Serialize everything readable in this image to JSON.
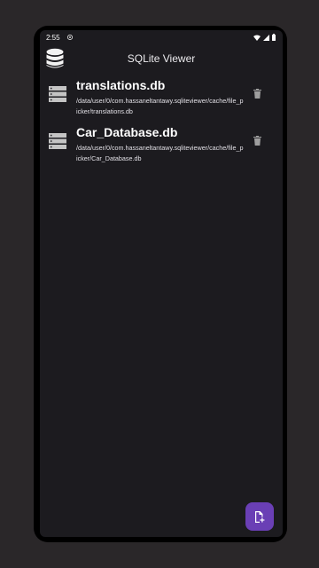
{
  "status_bar": {
    "time": "2:55",
    "icons": [
      "notification-icon",
      "wifi-icon",
      "signal-icon",
      "battery-icon"
    ]
  },
  "app_bar": {
    "title": "SQLite Viewer",
    "logo_icon": "database-icon"
  },
  "databases": [
    {
      "name": "translations.db",
      "path": "/data/user/0/com.hassaneltantawy.sqliteviewer/cache/file_picker/translations.db",
      "icon": "storage-icon",
      "action_icon": "delete-icon"
    },
    {
      "name": "Car_Database.db",
      "path": "/data/user/0/com.hassaneltantawy.sqliteviewer/cache/file_picker/Car_Database.db",
      "icon": "storage-icon",
      "action_icon": "delete-icon"
    }
  ],
  "fab": {
    "icon": "add-file-icon"
  },
  "colors": {
    "background": "#1c1b1f",
    "fab": "#6a3fb5",
    "icon_gray": "#9e9e9e"
  }
}
